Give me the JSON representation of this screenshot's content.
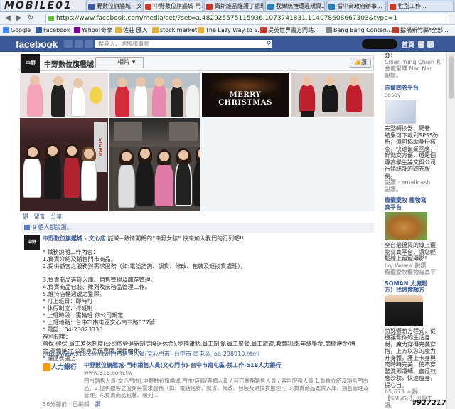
{
  "browser": {
    "site_logo": "MOBILE01",
    "tabs": [
      {
        "label": "野數位旗艦城 - 文..."
      },
      {
        "label": "中野數位旗艦城-門..."
      },
      {
        "label": "衛斯維晶維護了處理..."
      },
      {
        "label": "我樂統禮遭違規資..."
      },
      {
        "label": "當中商政府辦事..."
      },
      {
        "label": "性別工作..."
      }
    ],
    "url": "https://www.facebook.com/media/set/?set=a.482925575115936.1073741831.114078608667303&type=1",
    "bookmarks": [
      {
        "label": "Google"
      },
      {
        "label": "Facebook"
      },
      {
        "label": "Yahoo!奇摩"
      },
      {
        "label": "佐莊 匯入"
      },
      {
        "label": "stock market"
      },
      {
        "label": "The Lazy Way to S..."
      },
      {
        "label": "提英世界書方同站..."
      },
      {
        "label": "Bang Bang Conten..."
      },
      {
        "label": "擋禍新竹縣*全部..."
      }
    ]
  },
  "fb": {
    "logo": "facebook",
    "search_placeholder": "搜尋人、地標和事物",
    "home": "首頁"
  },
  "album": {
    "avatar_text": "中野",
    "title": "中野數位旗艦城 - 文心店",
    "album_button": "相片",
    "like_button": "讚",
    "photo_caption": "MERRY CHRISTMAS",
    "store_sign": "SIGMA"
  },
  "actions": {
    "like": "讚",
    "comment": "留言",
    "share": "分享"
  },
  "likes": {
    "text": "9 個人都說讚。"
  },
  "comment": {
    "avatar_text": "中野",
    "author": "中野數位旗艦城 - 文心店",
    "intro": "誠徵~熱情開朗的“中野女孩” 快來加入我們的行列吧!!",
    "lines": [
      "* 職務說明工作內容：",
      "1.負責介紹及銷售門市商品。",
      "2.提供顧客之服務與需求服務（如:電話諮詢、調貨、修改、包裝及退換貨處理）。",
      "",
      "3.負責商品進貨入庫、銷售管理及庫存管理。",
      "4.負責商品包裝、陳列及庶務品管理工作。",
      "5.維持店櫃週邊之整潔。",
      "* 可上班日：即時可",
      "* 休假制度：排班制",
      "* 上班時段：需輪班 依公司規定",
      "* 上班地點：台中市南屯區文心南三路677號",
      "* 電話：04-23823336",
      "福利制度：",
      "勞保,健保,員工差休制度(公司依勞退新制提撥退休金),步補津貼,員工制服,員工聚餐,員工旅遊,教育訓練,年終獎金,節慶禮金/禮品,生育、婚喪補助",
      "金,業績獎金,公司產品優惠價,彈性輪休。",
      "* 履歷表請上："
    ],
    "job_link": "http://www.518.com.tw/門市銷售人員(文心門市)-台中市-南屯區-job-298910.html"
  },
  "link_card": {
    "logo": "人力銀行",
    "title": "中野數位旗艦城-門市銷售人員(文心門市)-台中市南屯區-找工作-518人力銀行",
    "domain": "www.518.com.tw",
    "desc1": "門市銷售人員(文心門市),中野數位旗艦城,門市/店員/專櫃人員 / 其它業務銷售人員 / 客戶服務人員,1.負責介紹及銷售門市商",
    "desc2": "品。2.提供顧客之服務與需求服務（如：電話諮詢、調貨、修改、包裝及退換貨處理）。3.負責商品進貨入庫、銷售管理及庫存",
    "desc3": "管理。4.負責商品包裝、陳列..."
  },
  "footer": {
    "time": "56分鐘前",
    "share": "已編輯",
    "like": "讚"
  },
  "sidebar": {
    "s1_line1": "夯！",
    "s1_names": "Chien Yung Chien 和",
    "s1_names2": "金億緊螺 Nac Nac",
    "s1_names3": "說讚。",
    "s2_title": "赤爾問卷平台",
    "s2_sub": "sosay",
    "s2_text1": "完整轉換器、問卷",
    "s2_text2": "結果可下載到SPSS分",
    "s2_text3": "析，還可協助身份核",
    "s2_text4": "查，快速幫業回應，",
    "s2_text5": "鮮豔交方便，還是個",
    "s2_text6": "專為學生論文與公司",
    "s2_text7": "行銷統計的問卷服",
    "s2_text8": "務。",
    "s2_like": "說讚 · emailcash",
    "s2_like2": "說讚。",
    "s3_title": "寵寵愛牧 寵物寫",
    "s3_title2": "真平台",
    "s3_text1": "全台最優質的線上寵",
    "s3_text2": "物寫真平台，讓您輕",
    "s3_text3": "鬆線上寵寵攝影！",
    "s3_like": "Ivy Woww 說讚",
    "s3_like2": "寵寵愛牧寵物寫真平",
    "s4_title": "SOMAN 太魔粉",
    "s4_title2": "方】找您撐顏方",
    "s4_text1": "特殊鬱軌方程式，從",
    "s4_text2": "機讓牽你的生活身",
    "s4_text3": "材，魔力穿得完美穿",
    "s4_text4": "搭，上方以您的魔力",
    "s4_text5": "升身體，護上卡身與",
    "s4_text6": "肉時時完美，使不穿",
    "s4_text7": "整洗即運轉，直徑效",
    "s4_text8": "應沙貌，快速瘦身，",
    "s4_text9": "提心自。",
    "s4_count": "65,673 人說",
    "s4_count2": "【SMyGo】也說工",
    "s4_count3": "讚。"
  },
  "watermark": "#927217"
}
